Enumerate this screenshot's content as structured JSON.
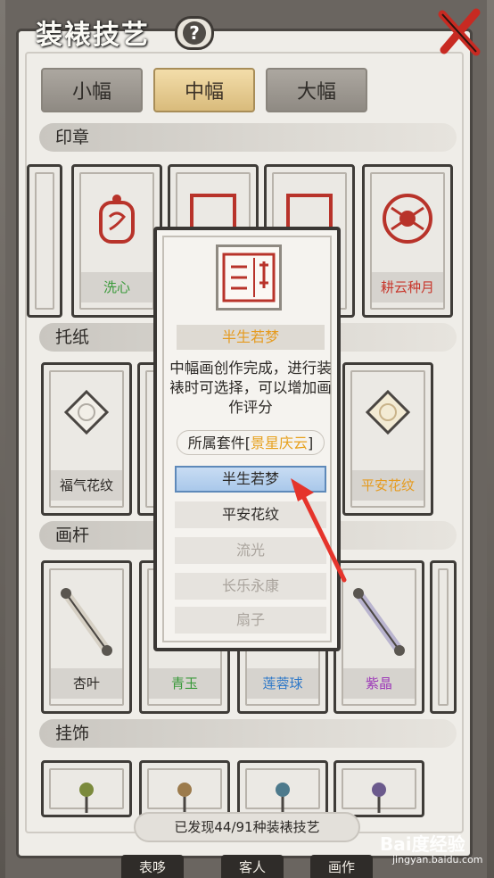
{
  "title": "装裱技艺",
  "help_label": "?",
  "size_tabs": [
    "小幅",
    "中幅",
    "大幅"
  ],
  "sections": {
    "seal": "印章",
    "paper": "托纸",
    "rod": "画杆",
    "ornament": "挂饰"
  },
  "seal_cards": [
    "洗心",
    "",
    "",
    "耕云种月"
  ],
  "paper_cards": [
    "福气花纹",
    "",
    "",
    "平安花纹"
  ],
  "rod_cards": [
    "杏叶",
    "青玉",
    "莲蓉球",
    "紫晶"
  ],
  "label_colors": {
    "green": "#3a9a3a",
    "red": "#c8372c",
    "blue": "#2e78c8",
    "purple": "#9d39b8",
    "orange": "#e59b20"
  },
  "popup": {
    "name": "半生若梦",
    "description": "中幅画创作完成，进行装裱时可选择，可以增加画作评分",
    "set_label": "所属套件",
    "set_value": "景星庆云",
    "options": [
      "半生若梦",
      "平安花纹",
      "流光",
      "长乐永康",
      "扇子"
    ]
  },
  "footer_text": "已发现44/91种装裱技艺",
  "bottom_nav": [
    "表哆",
    "客人",
    "画作"
  ],
  "watermark": {
    "logo": "Bai度经验",
    "url": "jingyan.baidu.com"
  }
}
